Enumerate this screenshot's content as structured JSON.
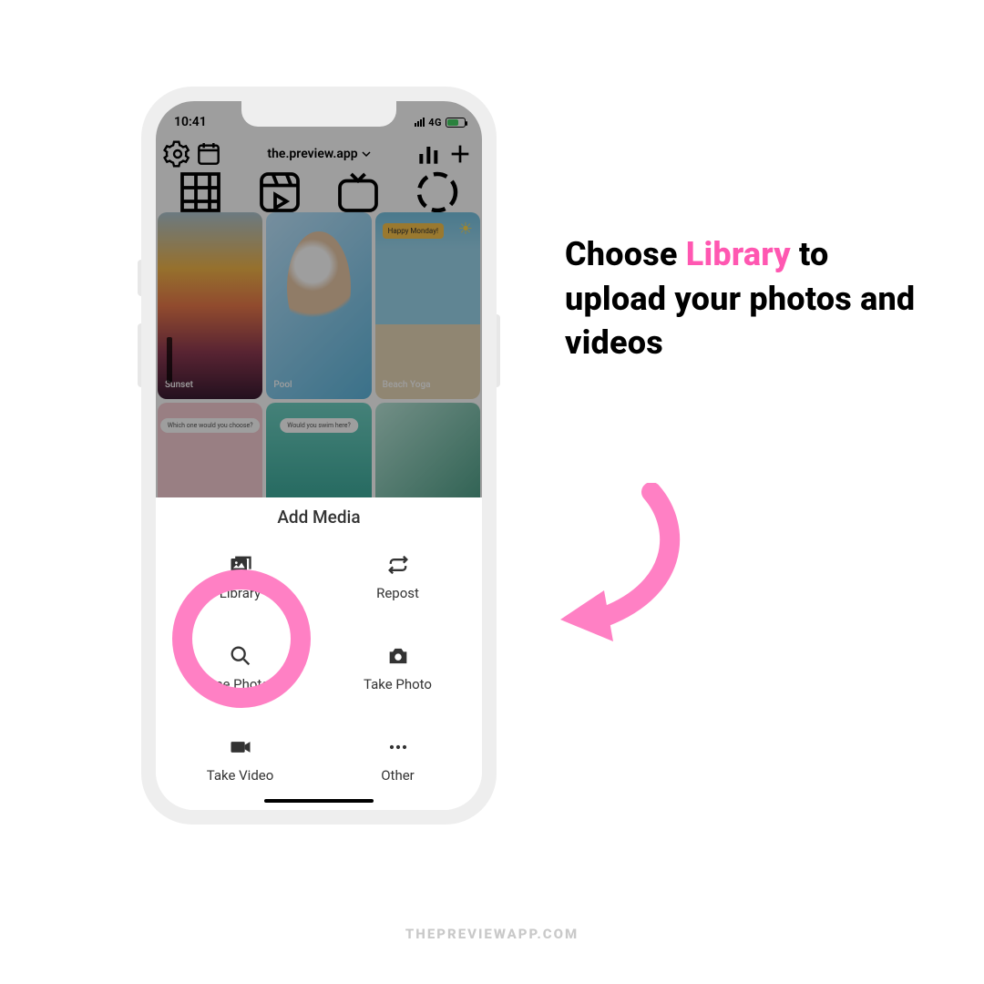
{
  "status": {
    "time": "10:41",
    "net": "4G"
  },
  "app": {
    "account": "the.preview.app"
  },
  "gallery": {
    "cards": [
      {
        "label": "Sunset"
      },
      {
        "label": "Pool"
      },
      {
        "label": "Beach Yoga",
        "tag": "Happy Monday!"
      },
      {
        "label": "Which one would you choose?"
      },
      {
        "label": "Would you swim here?"
      },
      {
        "label": ""
      }
    ]
  },
  "sheet": {
    "title": "Add Media",
    "options": {
      "library": "Library",
      "repost": "Repost",
      "free_photos": "Free Photos",
      "take_photo": "Take Photo",
      "take_video": "Take Video",
      "other": "Other"
    }
  },
  "annotation": {
    "pre": "Choose ",
    "highlight": "Library",
    "post": " to upload your photos and videos"
  },
  "footer": "THEPREVIEWAPP.COM",
  "colors": {
    "accent_pink": "#ff80c4",
    "text_pink": "#ff57b1"
  }
}
